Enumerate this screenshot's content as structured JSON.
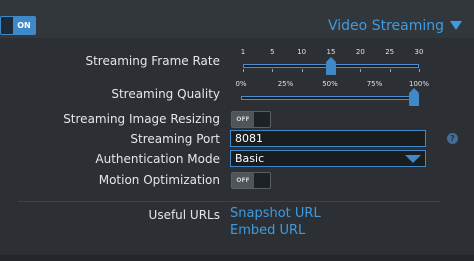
{
  "header": {
    "toggle_label": "ON",
    "section_title": "Video Streaming"
  },
  "settings": {
    "frame_rate": {
      "label": "Streaming Frame Rate",
      "ticks": [
        "1",
        "5",
        "10",
        "15",
        "20",
        "25",
        "30"
      ],
      "value": 15
    },
    "quality": {
      "label": "Streaming Quality",
      "ticks": [
        "0%",
        "25%",
        "50%",
        "75%",
        "100%"
      ],
      "value_percent": 100
    },
    "image_resizing": {
      "label": "Streaming Image Resizing",
      "toggle_label": "OFF"
    },
    "port": {
      "label": "Streaming Port",
      "value": "8081"
    },
    "auth_mode": {
      "label": "Authentication Mode",
      "value": "Basic"
    },
    "motion_optimization": {
      "label": "Motion Optimization",
      "toggle_label": "OFF"
    },
    "help_icon_glyph": "?"
  },
  "useful_urls": {
    "label": "Useful URLs",
    "links": [
      "Snapshot URL",
      "Embed URL"
    ]
  },
  "colors": {
    "accent": "#3f89c9",
    "link": "#3f9be0",
    "background": "#2c3034"
  }
}
